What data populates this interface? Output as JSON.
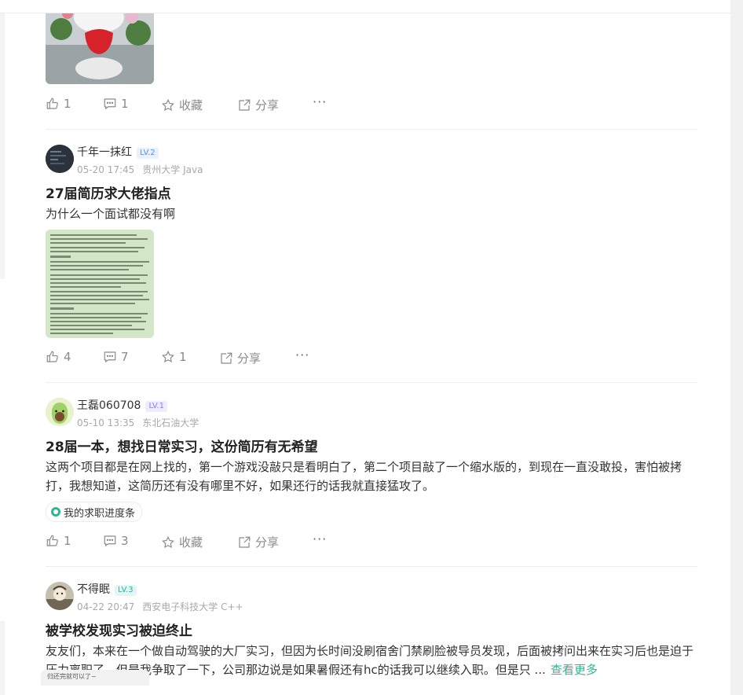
{
  "posts": [
    {
      "actions": {
        "like": "1",
        "comment": "1",
        "favorite": "收藏",
        "share": "分享",
        "more": "···"
      }
    },
    {
      "author": "千年一抹红",
      "level": "LV.2",
      "time": "05-20 17:45",
      "school": "贵州大学 Java",
      "title": "27届简历求大佬指点",
      "body": "为什么一个面试都没有啊",
      "actions": {
        "like": "4",
        "comment": "7",
        "favorite": "1",
        "share": "分享",
        "more": "···"
      }
    },
    {
      "author": "王磊060708",
      "level": "LV.1",
      "time": "05-10 13:35",
      "school": "东北石油大学",
      "title": "28届一本，想找日常实习，这份简历有无希望",
      "body": "这两个项目都是在网上找的，第一个游戏没敲只是看明白了，第二个项目敲了一个缩水版的，到现在一直没敢投，害怕被拷打，我想知道，这简历还有没有哪里不好，如果还行的话我就直接猛攻了。",
      "tag": "我的求职进度条",
      "actions": {
        "like": "1",
        "comment": "3",
        "favorite": "收藏",
        "share": "分享",
        "more": "···"
      }
    },
    {
      "author": "不得眠",
      "level": "LV.3",
      "time": "04-22 20:47",
      "school": "西安电子科技大学 C++",
      "title": "被学校发现实习被迫终止",
      "body": "友友们，本来在一个做自动驾驶的大厂实习，但因为长时间没刷宿舍门禁刷脸被导员发现，后面被拷问出来在实习后也是迫于压力离职了。但是我争取了一下，公司那边说是如果暑假还有hc的话我可以继续入职。但是只 ...",
      "read_more": "查看更多",
      "thumb_caption": "归还完就可以了~"
    }
  ],
  "colors": {
    "accent": "#31b58f",
    "lv1_text": "#8b7cf0",
    "lv1_bg": "#efedfd",
    "lv2_text": "#5b8def",
    "lv2_bg": "#eaf1fd",
    "lv3_text": "#25b5a4",
    "lv3_bg": "#e4f6f3"
  },
  "icons": [
    "thumb-up-icon",
    "comment-icon",
    "star-icon",
    "share-icon",
    "more-icon"
  ]
}
